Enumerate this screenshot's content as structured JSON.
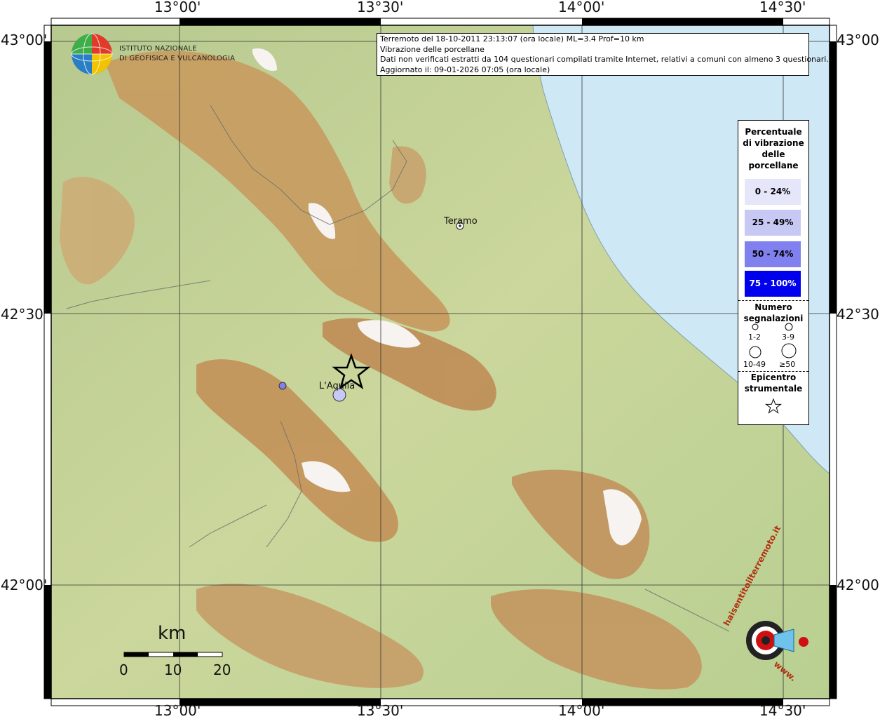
{
  "header_info": {
    "line1": "Terremoto del 18-10-2011 23:13:07 (ora locale) ML=3.4 Prof=10 km",
    "line2": "Vibrazione delle porcellane",
    "line3": "Dati non verificati estratti da 104 questionari compilati tramite Internet, relativi a comuni con almeno 3 questionari.",
    "line4": "Aggiornato il: 09-01-2026 07:05 (ora locale)"
  },
  "logo": {
    "icon": "ingv-globe-logo",
    "line1": "ISTITUTO NAZIONALE",
    "line2": "DI GEOFISICA E VULCANOLOGIA"
  },
  "axes": {
    "top_labels": [
      "13°00'",
      "13°30'",
      "14°00'",
      "14°30'"
    ],
    "bottom_labels": [
      "13°00'",
      "13°30'",
      "14°00'",
      "14°30'"
    ],
    "left_labels": [
      "43°00'",
      "42°30'",
      "42°00'"
    ],
    "right_labels": [
      "43°00'",
      "42°30'",
      "42°00'"
    ]
  },
  "cities": [
    {
      "name": "Teramo"
    },
    {
      "name": "L'Aquila"
    }
  ],
  "legend": {
    "title": [
      "Percentuale",
      "di vibrazione",
      "delle",
      "porcellane"
    ],
    "classes": [
      {
        "label": "0 - 24%",
        "color": "#e6e6fa",
        "text_color": "#000000"
      },
      {
        "label": "25 - 49%",
        "color": "#c8c8f5",
        "text_color": "#000000"
      },
      {
        "label": "50 - 74%",
        "color": "#8080ee",
        "text_color": "#000000"
      },
      {
        "label": "75 - 100%",
        "color": "#0000ee",
        "text_color": "#ffffff"
      }
    ],
    "count_title": [
      "Numero",
      "segnalazioni"
    ],
    "count_classes": [
      "1-2",
      "3-9",
      "10-49",
      "≥50"
    ],
    "epicenter_title": [
      "Epicentro",
      "strumentale"
    ]
  },
  "scalebar": {
    "unit": "km",
    "ticks": [
      "0",
      "10",
      "20"
    ]
  },
  "watermark": {
    "text": "haisentitoilterremoto.it",
    "url_text": "www.",
    "icon": "haisentitoilterremoto-logo"
  },
  "colors": {
    "sea": "#cfe8f5",
    "lowland": "#c9d9a0",
    "hills": "#d8c98e",
    "mountains": "#b58a55",
    "peaks": "#f4f0ec"
  }
}
